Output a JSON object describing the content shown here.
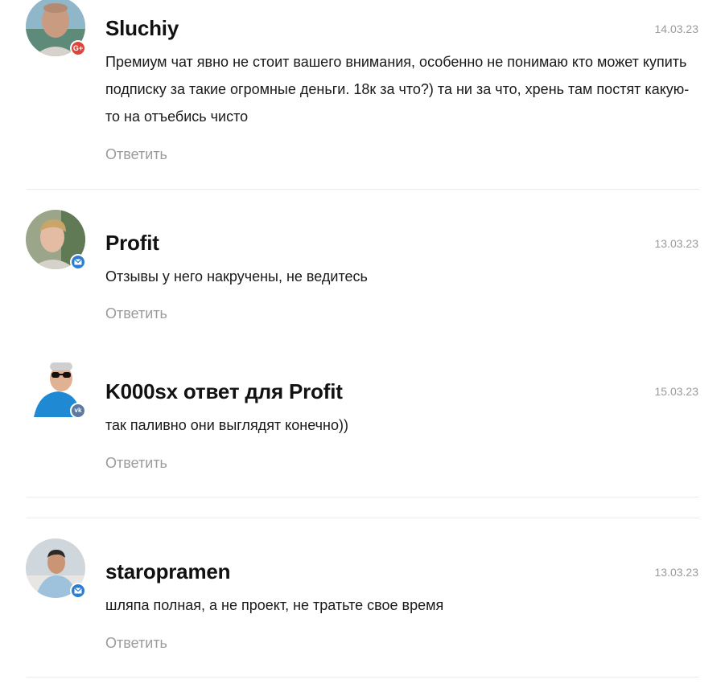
{
  "comments": [
    {
      "author": "Sluchiy",
      "date": "14.03.23",
      "text": "Премиум чат явно не стоит вашего внимания, особенно не понимаю кто может купить подписку за такие огромные деньги. 18к за что?) та ни за что, хрень там постят какую-то на отъебись чисто",
      "reply_label": "Ответить",
      "badge": "google-plus-icon",
      "badge_text": "G+",
      "badge_color": "#e0453a"
    },
    {
      "author": "Profit",
      "date": "13.03.23",
      "text": "Отзывы у него накручены, не ведитесь",
      "reply_label": "Ответить",
      "badge": "mail-icon",
      "badge_color": "#2b7cd3"
    },
    {
      "author": "K000sx ответ для Profit",
      "date": "15.03.23",
      "text": "так паливно они выглядят конечно))",
      "reply_label": "Ответить",
      "badge": "vk-icon",
      "badge_color": "#5b7aa3"
    },
    {
      "author": "staropramen",
      "date": "13.03.23",
      "text": "шляпа полная, а не проект, не тратьте свое время",
      "reply_label": "Ответить",
      "badge": "mail-icon",
      "badge_color": "#2b7cd3"
    }
  ]
}
